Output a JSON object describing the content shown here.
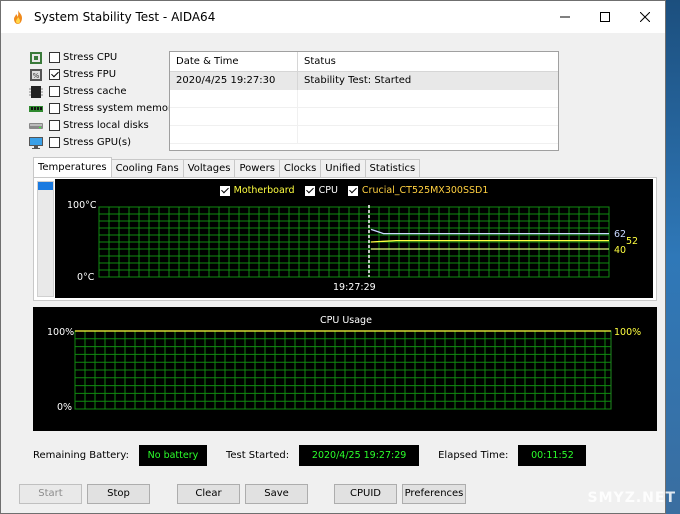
{
  "window": {
    "title": "System Stability Test - AIDA64",
    "minimize_label": "minimize",
    "maximize_label": "maximize",
    "close_label": "close"
  },
  "stress": [
    {
      "label": "Stress CPU",
      "checked": false,
      "icon": "cpu-chip-icon"
    },
    {
      "label": "Stress FPU",
      "checked": true,
      "icon": "fpu-chip-icon"
    },
    {
      "label": "Stress cache",
      "checked": false,
      "icon": "cache-chip-icon"
    },
    {
      "label": "Stress system memory",
      "checked": false,
      "icon": "memory-stick-icon"
    },
    {
      "label": "Stress local disks",
      "checked": false,
      "icon": "disk-drive-icon"
    },
    {
      "label": "Stress GPU(s)",
      "checked": false,
      "icon": "gpu-monitor-icon"
    }
  ],
  "log": {
    "headers": [
      "Date & Time",
      "Status"
    ],
    "rows": [
      {
        "datetime": "2020/4/25 19:27:30",
        "status": "Stability Test: Started"
      }
    ]
  },
  "tabs": [
    {
      "label": "Temperatures",
      "active": true
    },
    {
      "label": "Cooling Fans",
      "active": false
    },
    {
      "label": "Voltages",
      "active": false
    },
    {
      "label": "Powers",
      "active": false
    },
    {
      "label": "Clocks",
      "active": false
    },
    {
      "label": "Unified",
      "active": false
    },
    {
      "label": "Statistics",
      "active": false
    }
  ],
  "temp_graph": {
    "legend": [
      {
        "name": "Motherboard",
        "color": "#ffff40"
      },
      {
        "name": "CPU",
        "color": "#ffffff"
      },
      {
        "name": "Crucial_CT525MX300SSD1",
        "color": "#ffd040"
      }
    ],
    "y_max_label": "100°C",
    "y_min_label": "0°C",
    "marker_time": "19:27:29",
    "values": {
      "cpu": "62",
      "motherboard": "52",
      "ssd": "40"
    },
    "cpu_color": "#c8d8ff",
    "mb_color": "#ffff40",
    "ssd_color": "#e6ff80"
  },
  "chart_data": {
    "type": "line",
    "title": "",
    "xlabel": "",
    "ylabel": "",
    "ylim": [
      0,
      100
    ],
    "x_marker": "19:27:29",
    "series": [
      {
        "name": "CPU",
        "values": [
          68,
          62,
          62,
          62,
          62,
          62,
          62,
          62,
          62,
          62,
          62,
          62,
          62,
          62,
          62,
          62,
          62,
          62,
          62,
          62
        ]
      },
      {
        "name": "Motherboard",
        "values": [
          50,
          51,
          52,
          52,
          52,
          52,
          52,
          52,
          52,
          52,
          52,
          52,
          52,
          52,
          52,
          52,
          52,
          52,
          52,
          52
        ]
      },
      {
        "name": "Crucial_CT525MX300SSD1",
        "values": [
          40,
          40,
          40,
          40,
          40,
          40,
          40,
          40,
          40,
          40,
          40,
          40,
          40,
          40,
          40,
          40,
          40,
          40,
          40,
          40
        ]
      }
    ]
  },
  "cpu_graph": {
    "title": "CPU Usage",
    "y_max_label": "100%",
    "y_min_label": "0%",
    "current_value": "100%"
  },
  "status": {
    "battery_label": "Remaining Battery:",
    "battery_value": "No battery",
    "started_label": "Test Started:",
    "started_value": "2020/4/25 19:27:29",
    "elapsed_label": "Elapsed Time:",
    "elapsed_value": "00:11:52"
  },
  "buttons": {
    "start": "Start",
    "stop": "Stop",
    "clear": "Clear",
    "save": "Save",
    "cpuid": "CPUID",
    "preferences": "Preferences"
  },
  "watermark": "SMYZ.NET"
}
